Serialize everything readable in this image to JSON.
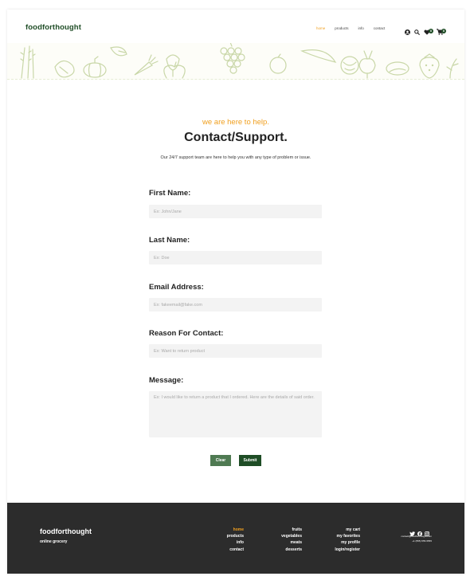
{
  "header": {
    "logo": "foodforthought",
    "nav": [
      {
        "label": "home",
        "active": true
      },
      {
        "label": "products",
        "active": false
      },
      {
        "label": "info",
        "active": false
      },
      {
        "label": "contact",
        "active": false
      }
    ],
    "icons": [
      "user-icon",
      "search-icon",
      "favorites-icon",
      "cart-icon"
    ],
    "favorites_count": "0",
    "cart_count": "0"
  },
  "banner": {
    "icons": [
      "asparagus-icon",
      "grapes-icon",
      "apple-icon",
      "strawberry-icon",
      "carrot-icon",
      "pumpkin-icon"
    ]
  },
  "intro": {
    "eyebrow": "we are here to help.",
    "title": "Contact/Support.",
    "subtitle": "Our 24/7 support team are here to help you with any type of problem or issue."
  },
  "form": {
    "first_name": {
      "label": "First Name:",
      "placeholder": "Ex: John/Jane",
      "value": ""
    },
    "last_name": {
      "label": "Last Name:",
      "placeholder": "Ex: Doe",
      "value": ""
    },
    "email": {
      "label": "Email Address:",
      "placeholder": "Ex: fakeemail@fake.com",
      "value": ""
    },
    "reason": {
      "label": "Reason For Contact:",
      "placeholder": "Ex: Want to return product",
      "value": ""
    },
    "message": {
      "label": "Message:",
      "placeholder": "Ex: I would like to return a product that I ordered. Here are the details of said order.",
      "value": ""
    },
    "clear_label": "Clear",
    "submit_label": "Submit"
  },
  "footer": {
    "logo": "foodforthought",
    "tagline": "online grocery",
    "col1": [
      {
        "label": "home",
        "active": true
      },
      {
        "label": "products",
        "active": false
      },
      {
        "label": "info",
        "active": false
      },
      {
        "label": "contact",
        "active": false
      }
    ],
    "col2": [
      "fruits",
      "vegetables",
      "meats",
      "desserts"
    ],
    "col3": [
      "my cart",
      "my favorites",
      "my profile",
      "login/register"
    ],
    "social": [
      "twitter-icon",
      "facebook-icon",
      "instagram-icon"
    ],
    "email": "contact@foodforthought.com",
    "phone": "+1 (555) 555-5555"
  },
  "colors": {
    "brand": "#1f4d26",
    "accent": "#f0a020",
    "footer_bg": "#2c2c2c"
  }
}
